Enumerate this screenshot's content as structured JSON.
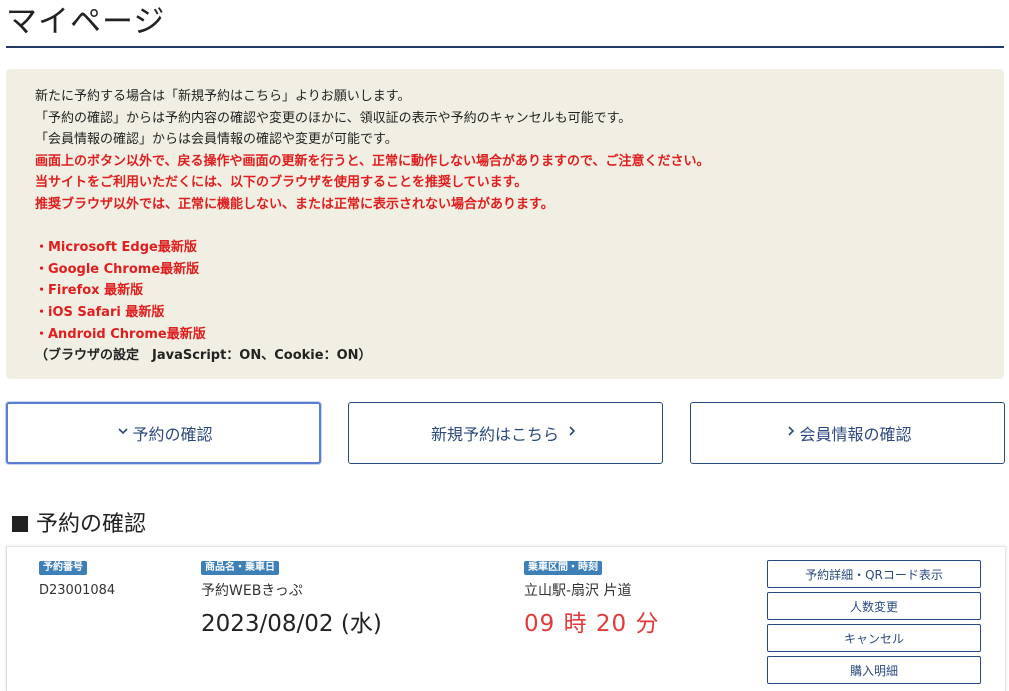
{
  "page": {
    "title": "マイページ"
  },
  "notice": {
    "lines": [
      "新たに予約する場合は「新規予約はこちら」よりお願いします。",
      "「予約の確認」からは予約内容の確認や変更のほかに、領収証の表示や予約のキャンセルも可能です。",
      "「会員情報の確認」からは会員情報の確認や変更が可能です。"
    ],
    "warnings": [
      "画面上のボタン以外で、戻る操作や画面の更新を行うと、正常に動作しない場合がありますので、ご注意ください。",
      "当サイトをご利用いただくには、以下のブラウザを使用することを推奨しています。",
      "推奨ブラウザ以外では、正常に機能しない、または正常に表示されない場合があります。"
    ],
    "browsers": [
      "・Microsoft Edge最新版",
      "・Google Chrome最新版",
      "・Firefox 最新版",
      "・iOS Safari 最新版",
      "・Android Chrome最新版"
    ],
    "settings": "（ブラウザの設定　JavaScript：ON、Cookie：ON）"
  },
  "nav": {
    "confirm_label": "予約の確認",
    "new_label": "新規予約はこちら",
    "member_label": "会員情報の確認",
    "confirm_icon": "chevron-down-icon",
    "new_icon": "chevron-right-icon",
    "member_icon": "chevron-right-icon"
  },
  "section": {
    "title": "予約の確認"
  },
  "reservation": {
    "number_badge": "予約番号",
    "number": "D23001084",
    "product_badge": "商品名・乗車日",
    "product": "予約WEBきっぷ",
    "date": "2023/08/02 (水)",
    "route_badge": "乗車区間・時刻",
    "route": "立山駅-扇沢 片道",
    "time": "09 時 20 分",
    "actions": {
      "detail": "予約詳細・QRコード表示",
      "change": "人数変更",
      "cancel": "キャンセル",
      "purchase": "購入明細"
    }
  },
  "colors": {
    "accent": "#2a4a7f",
    "warning": "#e01e1e",
    "badge": "#3d7fb7",
    "notice_bg": "#f1efe3"
  }
}
